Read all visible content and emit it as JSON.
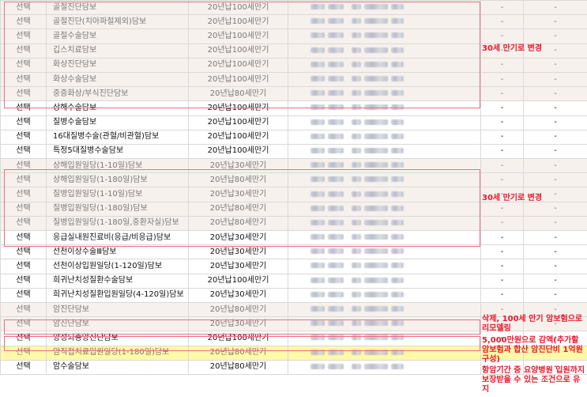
{
  "select_label": "선택",
  "dash": "-",
  "rows": [
    {
      "name": "골절진단담보",
      "term": "20년납100세만기"
    },
    {
      "name": "골절진단(치아파절제외)담보",
      "term": "20년납100세만기"
    },
    {
      "name": "골절수술담보",
      "term": "20년납100세만기"
    },
    {
      "name": "깁스치료담보",
      "term": "20년납100세만기"
    },
    {
      "name": "화상진단담보",
      "term": "20년납100세만기"
    },
    {
      "name": "화상수술담보",
      "term": "20년납100세만기"
    },
    {
      "name": "중증화상/부식진단담보",
      "term": "20년납80세만기"
    },
    {
      "name": "상해수술담보",
      "term": "20년납100세만기"
    },
    {
      "name": "질병수술담보",
      "term": "20년납100세만기"
    },
    {
      "name": "16대질병수술(관혈/비관혈)담보",
      "term": "20년납100세만기"
    },
    {
      "name": "특정5대질병수술담보",
      "term": "20년납100세만기"
    },
    {
      "name": "상해입원일당(1-10일)담보",
      "term": "20년납30세만기"
    },
    {
      "name": "상해입원일당(1-180일)담보",
      "term": "20년납80세만기"
    },
    {
      "name": "질병입원일당(1-10일)담보",
      "term": "20년납30세만기"
    },
    {
      "name": "질병입원일당(1-180일)담보",
      "term": "20년납80세만기"
    },
    {
      "name": "질병입원일당(1-180일,중환자실)담보",
      "term": "20년납80세만기"
    },
    {
      "name": "응급실내원진료비(응급/비응급)담보",
      "term": "20년납30세만기"
    },
    {
      "name": "선천이상수술Ⅲ담보",
      "term": "20년납30세만기"
    },
    {
      "name": "선천이상입원일당(1-120일)담보",
      "term": "20년납30세만기"
    },
    {
      "name": "희귀난치성질환수술담보",
      "term": "20년납100세만기"
    },
    {
      "name": "희귀난치성질환입원일당(4-120일)담보",
      "term": "20년납30세만기"
    },
    {
      "name": "암진단담보",
      "term": "20년납80세만기"
    },
    {
      "name": "암진단담보",
      "term": "20년납30세만기"
    },
    {
      "name": "양성뇌종양진단담보",
      "term": "20년납100세만기"
    },
    {
      "name": "암직접치료입원일당(1-180일)담보",
      "term": "20년납80세만기"
    },
    {
      "name": "암수술담보",
      "term": "20년납80세만기"
    }
  ],
  "notes": {
    "change_30_a": "30세 만기로 변경",
    "change_30_b": "30세 만기로 변경",
    "remodel": "삭제, 100세 만기 암보험으로 리모델링",
    "reduce": "5,000만원으로 감액(추가할 암보험과 합산 암진단비 1억원 구성)",
    "keep": "항암기간 중 요양병원 입원까지 보장받을 수 있는 조건으로 유지"
  }
}
